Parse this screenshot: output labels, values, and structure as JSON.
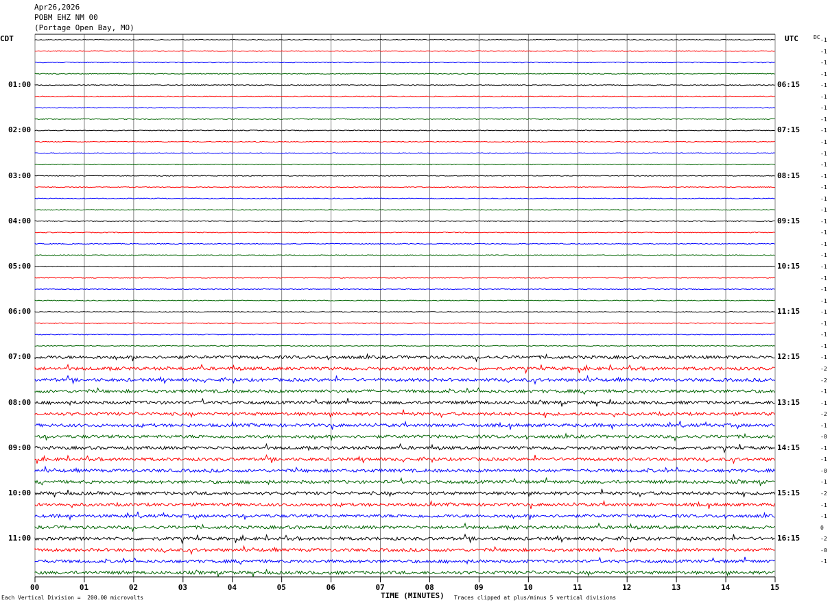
{
  "header": {
    "date": "Apr26,2026",
    "station": "POBM EHZ NM 00",
    "location": "(Portage Open Bay, MO)"
  },
  "left_axis_label": "CDT",
  "right_axis_label": "UTC",
  "dc_label": "DC",
  "x_axis_title": "TIME (MINUTES)",
  "x_ticks": [
    "00",
    "01",
    "02",
    "03",
    "04",
    "05",
    "06",
    "07",
    "08",
    "09",
    "10",
    "11",
    "12",
    "13",
    "14",
    "15"
  ],
  "left_hour_labels": [
    "01:00",
    "02:00",
    "03:00",
    "04:00",
    "05:00",
    "06:00",
    "07:00",
    "08:00",
    "09:00",
    "10:00",
    "11:00"
  ],
  "right_hour_labels": [
    "06:15",
    "07:15",
    "08:15",
    "09:15",
    "10:15",
    "11:15",
    "12:15",
    "13:15",
    "14:15",
    "15:15",
    "16:15"
  ],
  "dc_offsets": [
    "-1",
    "-1",
    "-1",
    "-1",
    "-1",
    "-1",
    "-1",
    "-1",
    "-1",
    "-1",
    "-1",
    "-1",
    "-1",
    "-1",
    "-1",
    "-1",
    "-1",
    "-1",
    "-1",
    "-1",
    "-1",
    "-1",
    "-1",
    "-1",
    "-1",
    "-1",
    "-1",
    "-1",
    "-1",
    "-2",
    "-2",
    "-1",
    "-1",
    "-2",
    "-1",
    "-0",
    "-1",
    "-1",
    "-0",
    "-1",
    "-2",
    "-1",
    "-1",
    "0",
    "-2",
    "-0",
    "-1"
  ],
  "footer": {
    "scale_note": "Each Vertical Division =  200.00 microvolts",
    "clip_note": "Traces clipped at plus/minus 5 vertical divisions"
  },
  "colors": {
    "trace_cycle": [
      "#000000",
      "#ff0000",
      "#0000ff",
      "#006400"
    ],
    "minute_grid": "#808080"
  }
}
